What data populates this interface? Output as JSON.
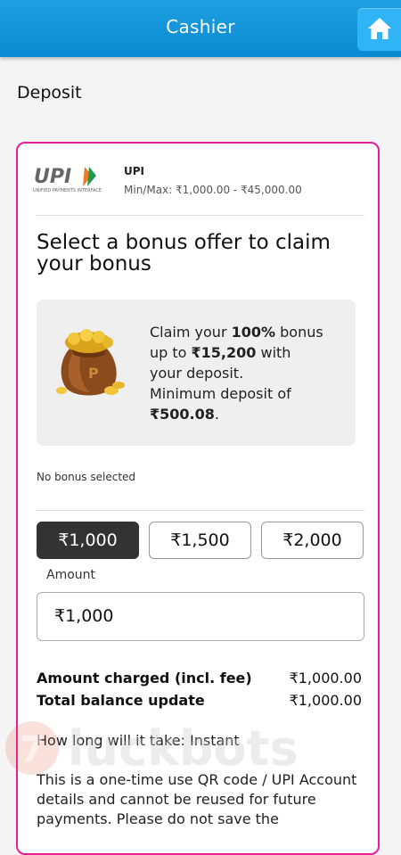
{
  "header": {
    "title": "Cashier",
    "home_icon": "home-icon"
  },
  "page": {
    "heading": "Deposit"
  },
  "method": {
    "name": "UPI",
    "limits": "Min/Max: ₹1,000.00 - ₹45,000.00",
    "logo_text": "UPI",
    "logo_subtext": "UNIFIED PAYMENTS INTERFACE"
  },
  "bonus": {
    "heading": "Select a bonus offer to claim your bonus",
    "offer": {
      "line1_pre": "Claim your ",
      "line1_bold": "100%",
      "line1_post": " bonus",
      "line2_pre": "up to ",
      "line2_bold": "₹15,200",
      "line2_post": " with",
      "line3": "your deposit.",
      "line4": "Minimum deposit of",
      "line5_bold": "₹500.08",
      "line5_post": "."
    },
    "status": "No bonus selected"
  },
  "amounts": {
    "options": [
      "₹1,000",
      "₹1,500",
      "₹2,000"
    ],
    "selected_index": 0,
    "label": "Amount",
    "value": "₹1,000"
  },
  "summary": {
    "charged_label": "Amount charged (incl. fee)",
    "charged_value": "₹1,000.00",
    "total_label": "Total balance update",
    "total_value": "₹1,000.00"
  },
  "info": {
    "time": "How long will it take: Instant",
    "notice": "This is a one-time use QR code / UPI Account details and cannot be reused for future payments. Please do not save the"
  },
  "colors": {
    "header": "#1497dc",
    "card_border": "#e51d9e",
    "selected_button": "#333333"
  }
}
